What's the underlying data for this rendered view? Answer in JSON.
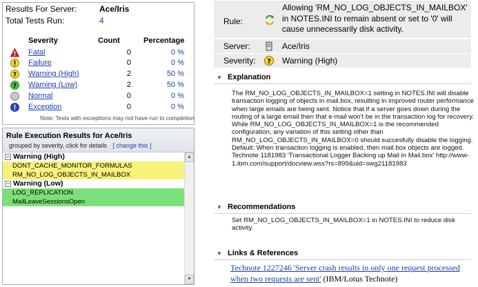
{
  "summary": {
    "server_label": "Results For Server:",
    "server_value": "Ace/Iris",
    "tests_label": "Total Tests Run:",
    "tests_value": "4",
    "headers": {
      "severity": "Severity",
      "count": "Count",
      "percentage": "Percentage"
    },
    "rows": [
      {
        "label": "Fatal",
        "count": "0",
        "pct": "0 %",
        "icon": "fatal-triangle-icon"
      },
      {
        "label": "Failure",
        "count": "0",
        "pct": "0 %",
        "icon": "failure-exclamation-icon"
      },
      {
        "label": "Warning (High)",
        "count": "2",
        "pct": "50 %",
        "icon": "warning-high-question-icon"
      },
      {
        "label": "Warning (Low)",
        "count": "2",
        "pct": "50 %",
        "icon": "warning-low-question-icon"
      },
      {
        "label": "Normal",
        "count": "0",
        "pct": "0 %",
        "icon": "normal-circle-icon"
      },
      {
        "label": "Exception",
        "count": "0",
        "pct": "0 %",
        "icon": "exception-exclamation-icon"
      }
    ],
    "note": "Note: Tests with exceptions may not have run to completion"
  },
  "results": {
    "title": "Rule Execution Results for Ace/Iris",
    "subtitle": "grouped by severity, click for details",
    "change_link": "[ change this ]",
    "groups": [
      {
        "label": "Warning (High)",
        "items": [
          "DONT_CACHE_MONITOR_FORMULAS",
          "RM_NO_LOG_OBJECTS_IN_MAILBOX"
        ]
      },
      {
        "label": "Warning (Low)",
        "items": [
          "LOG_REPLICATION",
          "MailLeaveSessionsOpen"
        ]
      }
    ]
  },
  "detail": {
    "rule_label": "Rule:",
    "rule_text": "Allowing 'RM_NO_LOG_OBJECTS_IN_MAILBOX' in NOTES.INI to remain absent or set to '0' will cause unnecessarily disk activity.",
    "server_label": "Server:",
    "server_value": "Ace/Iris",
    "severity_label": "Severity:",
    "severity_value": "Warning (High)",
    "explanation_title": "Explanation",
    "explanation_text": "The RM_NO_LOG_OBJECTS_IN_MAILBOX=1 setting in NOTES.INI will disable transaction logging of objects in mail.box, resulting in improved router performance when large emails are being sent. Notice that if a server goes down during the routing of a large email then that e-mail won't be in the transaction log for recovery. While RM_NO_LOG_OBJECTS_IN_MAILBOX=1 is the recommended configuration, any variation of this setting other than RM_NO_LOG_OBJECTS_IN_MAILBOX=0 should succesfully disable the logging. Default: When transaction logging is enabled, then mail.box objects are logged. Technote 1181983 'Transactional Logger Backing up Mail in Mail.box' http://www-1.ibm.com/support/docview.wss?rs=899&uid=swg21181983",
    "recommendations_title": "Recommendations",
    "recommendations_text": "Set RM_NO_LOG_OBJECTS_IN_MAILBOX=1 in NOTES.INI to reduce disk activity.",
    "links_title": "Links & References",
    "link_text": "Technote 1227246 'Server crash results in only one request processed when two requests are sent'",
    "link_suffix": " (IBM/Lotus Technote)"
  }
}
